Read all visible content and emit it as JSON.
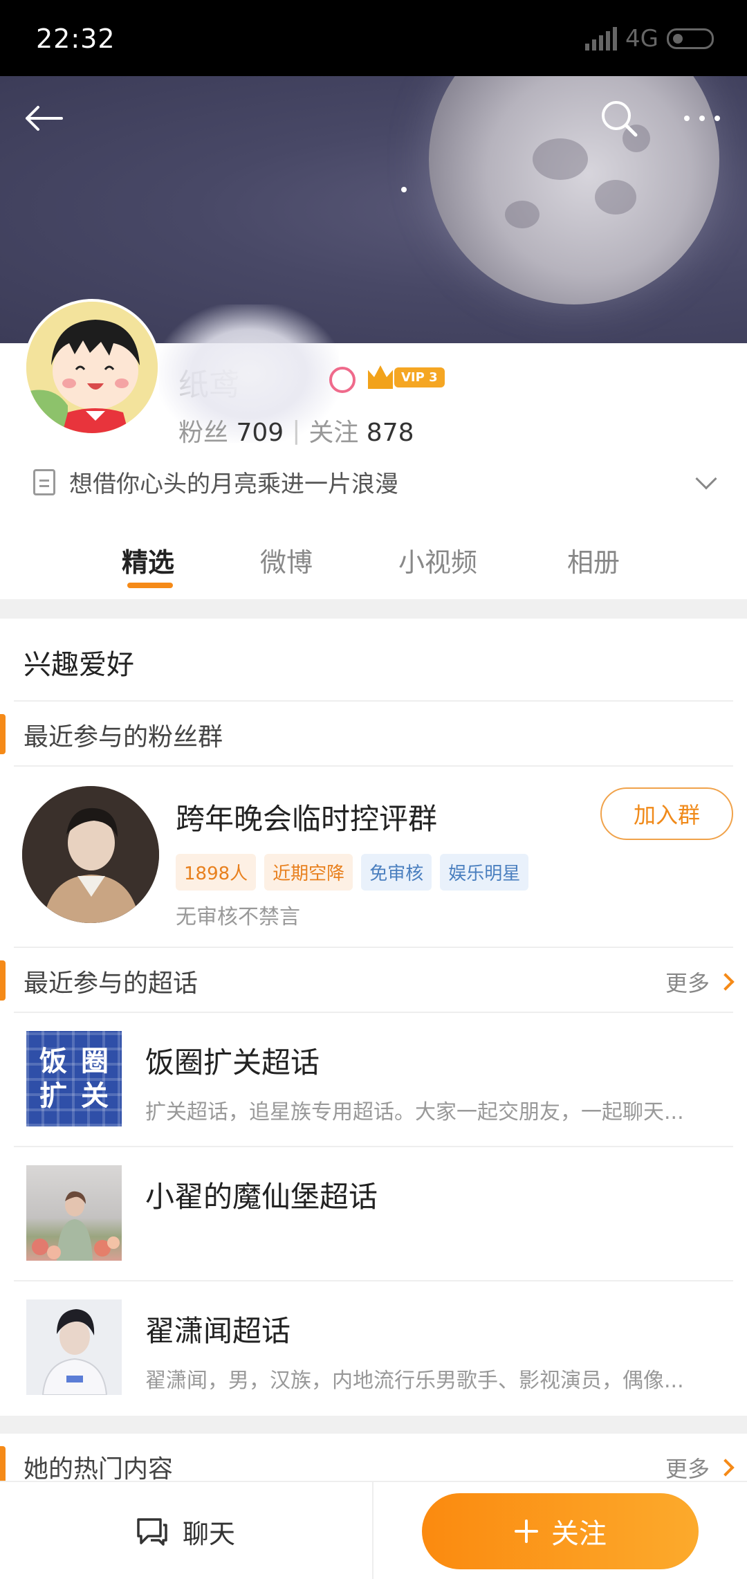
{
  "status_bar": {
    "time": "22:32",
    "network": "4G"
  },
  "header": {
    "back_icon": "arrow-left-icon",
    "search_icon": "search-icon",
    "more_icon": "more-dots-icon"
  },
  "profile": {
    "nickname": "纸鸢",
    "vip_label": "VIP 3",
    "fans_label": "粉丝",
    "fans_count": "709",
    "follow_label": "关注",
    "follow_count": "878",
    "bio": "想借你心头的月亮乘进一片浪漫"
  },
  "tabs": [
    {
      "label": "精选",
      "active": true
    },
    {
      "label": "微博"
    },
    {
      "label": "小视频"
    },
    {
      "label": "相册"
    }
  ],
  "interests": {
    "title": "兴趣爱好"
  },
  "fan_groups": {
    "title": "最近参与的粉丝群",
    "group": {
      "name": "跨年晚会临时控评群",
      "join_label": "加入群",
      "tags": [
        "1898人",
        "近期空降",
        "免审核",
        "娱乐明星"
      ],
      "description": "无审核不禁言"
    }
  },
  "super_topics": {
    "title": "最近参与的超话",
    "more_label": "更多",
    "items": [
      {
        "title": "饭圈扩关超话",
        "thumb_text": [
          "饭",
          "圈",
          "扩",
          "关"
        ],
        "desc": "扩关超话，追星族专用超话。大家一起交朋友，一起聊天..."
      },
      {
        "title": "小翟的魔仙堡超话",
        "desc": ""
      },
      {
        "title": "翟潇闻超话",
        "desc": "翟潇闻，男，汉族，内地流行乐男歌手、影视演员，偶像..."
      }
    ]
  },
  "hot_content": {
    "title": "她的热门内容",
    "more_label": "更多"
  },
  "bottom_bar": {
    "chat_label": "聊天",
    "follow_label": "关注"
  },
  "colors": {
    "accent": "#f58a18",
    "tag_orange": "#e8801e",
    "tag_blue": "#4a7fbf"
  }
}
